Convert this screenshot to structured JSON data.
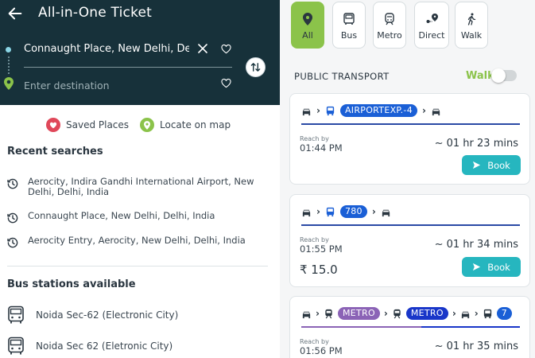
{
  "header": {
    "title": "All-in-One Ticket",
    "source_value": "Connaught Place, New Delhi, Delt",
    "destination_placeholder": "Enter destination"
  },
  "quick_actions": {
    "saved_places": "Saved Places",
    "locate_on_map": "Locate on map"
  },
  "recent": {
    "heading": "Recent searches",
    "items": [
      {
        "label": "Aerocity, Indira Gandhi International Airport, New Delhi, Delhi, India"
      },
      {
        "label": "Connaught Place, New Delhi, Delhi, India"
      },
      {
        "label": "Aerocity Entry, Aerocity, New Delhi, Delhi, India"
      }
    ]
  },
  "bus_stations": {
    "heading": "Bus stations available",
    "items": [
      {
        "label": "Noida Sec-62 (Electronic City)"
      },
      {
        "label": "Noida Sec 62 (Eletronic City)"
      }
    ]
  },
  "filters": [
    {
      "label": "All",
      "icon": "location-pin-icon",
      "active": true
    },
    {
      "label": "Bus",
      "icon": "bus-icon",
      "active": false
    },
    {
      "label": "Metro",
      "icon": "metro-icon",
      "active": false
    },
    {
      "label": "Direct",
      "icon": "direct-route-icon",
      "active": false
    },
    {
      "label": "Walk",
      "icon": "walk-icon",
      "active": false
    }
  ],
  "transport": {
    "section_title": "PUBLIC TRANSPORT",
    "walk_label": "Walk",
    "walk_toggle_on": false
  },
  "routes": [
    {
      "pills": [
        "AIRPORTEXP.-4"
      ],
      "reach_label": "Reach by",
      "reach_time": "01:44 PM",
      "duration": "~ 01 hr 23 mins",
      "price": "",
      "book_label": "Book"
    },
    {
      "pills": [
        "780"
      ],
      "reach_label": "Reach by",
      "reach_time": "01:55 PM",
      "duration": "~ 01 hr 34 mins",
      "price": "₹ 15.0",
      "book_label": "Book"
    },
    {
      "pills": [
        "METRO",
        "METRO",
        "7"
      ],
      "reach_label": "Reach by",
      "reach_time": "01:56 PM",
      "duration": "~ 01 hr 35 mins",
      "price": "",
      "book_label": ""
    }
  ],
  "colors": {
    "header_bg": "#17313a",
    "accent_green": "#8bc34a",
    "book_teal": "#26b6bf",
    "pill_blue": "#1a5fd6",
    "pill_purple": "#8b63b6",
    "pill_dark_blue": "#1936c9"
  }
}
